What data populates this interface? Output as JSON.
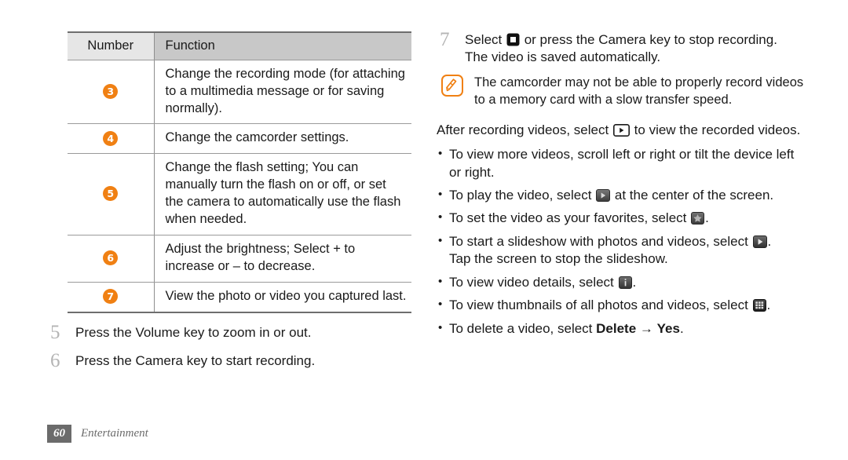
{
  "document": {
    "page_number": "60",
    "section_label": "Entertainment"
  },
  "colors": {
    "accent_orange": "#f08013",
    "header_light_gray": "#e6e6e6",
    "header_dark_gray": "#c8c8c8",
    "footer_gray": "#6b6b6b",
    "step_number_gray": "#b4b4b4"
  },
  "table": {
    "headers": {
      "number": "Number",
      "function": "Function"
    },
    "rows": [
      {
        "number": "3",
        "function": "Change the recording mode (for attaching to a multimedia message or for saving normally)."
      },
      {
        "number": "4",
        "function": "Change the camcorder settings."
      },
      {
        "number": "5",
        "function": "Change the flash setting; You can manually turn the flash on or off, or set the camera to automatically use the flash when needed."
      },
      {
        "number": "6",
        "function": "Adjust the brightness; Select + to increase or – to decrease."
      },
      {
        "number": "7",
        "function": "View the photo or video you captured last."
      }
    ]
  },
  "left_steps": [
    {
      "num": "5",
      "text": "Press the Volume key to zoom in or out."
    },
    {
      "num": "6",
      "text": "Press the Camera key to start recording."
    }
  ],
  "right": {
    "step7": {
      "num": "7",
      "text_before_icon": "Select",
      "icon": "stop-record-icon",
      "text_after_icon": "or press the Camera key to stop recording.",
      "line2": "The video is saved automatically."
    },
    "note": {
      "icon": "note-pen-icon",
      "text": "The camcorder may not be able to properly record videos to a memory card with a slow transfer speed."
    },
    "after_recording": {
      "text_before_icon": "After recording videos, select",
      "icon": "play-outline-icon",
      "text_after_icon": "to view the recorded videos."
    },
    "bullets": [
      {
        "text_before_icon": "To view more videos, scroll left or right or tilt the device left or right.",
        "icon": null,
        "text_after_icon": ""
      },
      {
        "text_before_icon": "To play the video, select",
        "icon": "play-button-icon",
        "text_after_icon": "at the center of the screen."
      },
      {
        "text_before_icon": "To set the video as your favorites, select",
        "icon": "favorite-star-icon",
        "text_after_icon": "."
      },
      {
        "text_before_icon": "To start a slideshow with photos and videos, select",
        "icon": "slideshow-play-icon",
        "text_after_icon": ".",
        "line2": "Tap the screen to stop the slideshow."
      },
      {
        "text_before_icon": "To view video details, select",
        "icon": "info-icon",
        "text_after_icon": "."
      },
      {
        "text_before_icon": "To view thumbnails of all photos and videos, select",
        "icon": "thumbnails-grid-icon",
        "text_after_icon": "."
      },
      {
        "text_before_icon": "To delete a video, select",
        "icon": null,
        "bold1": "Delete",
        "arrow": "→",
        "bold2": "Yes",
        "text_after_icon": "."
      }
    ]
  }
}
